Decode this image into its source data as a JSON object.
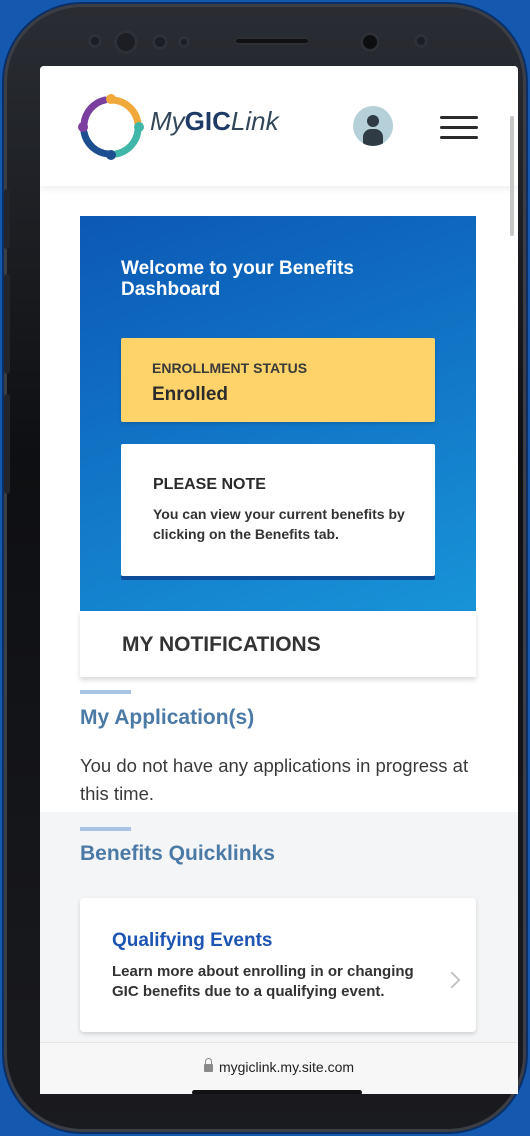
{
  "header": {
    "brand_prefix": "My",
    "brand_bold": "GIC",
    "brand_suffix": "Link",
    "icons": {
      "logo": "people-circle-logo",
      "avatar": "user-avatar-icon",
      "menu": "hamburger-menu-icon"
    }
  },
  "hero": {
    "title": "Welcome to your Benefits Dashboard",
    "status_label": "ENROLLMENT STATUS",
    "status_value": "Enrolled",
    "note_title": "PLEASE NOTE",
    "note_text": "You can view your current benefits by clicking on the Benefits tab."
  },
  "notifications": {
    "title": "MY NOTIFICATIONS"
  },
  "applications": {
    "title": "My Application(s)",
    "empty_text": "You do not have any applications in progress at this time."
  },
  "quicklinks": {
    "title": "Benefits Quicklinks",
    "items": [
      {
        "title": "Qualifying Events",
        "description": "Learn more about enrolling in or changing GIC benefits due to a qualifying event."
      }
    ]
  },
  "browser": {
    "url": "mygiclink.my.site.com"
  },
  "colors": {
    "primary_blue": "#0c58b4",
    "status_yellow": "#fdd36a",
    "section_blue": "#4c7aa6",
    "link_blue": "#1e55b3"
  }
}
